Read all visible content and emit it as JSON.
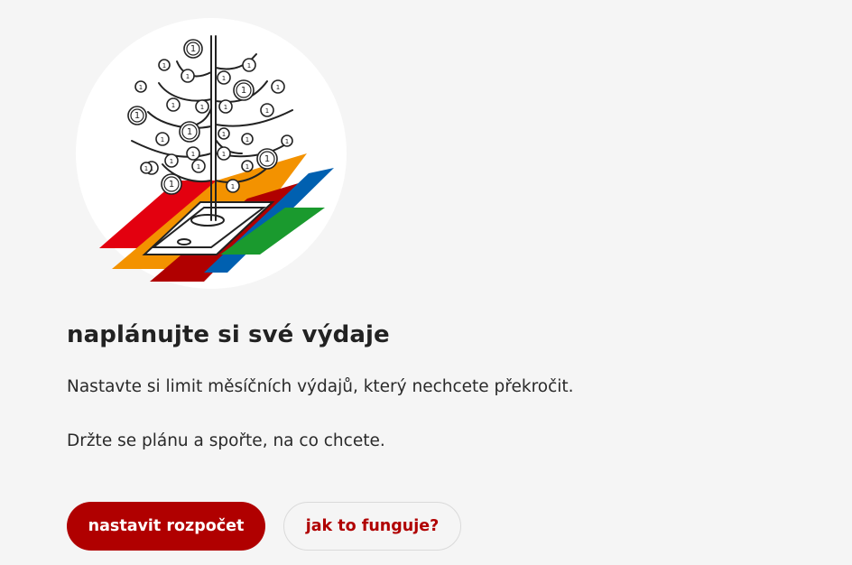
{
  "illustration": {
    "icon": "money-tree-phone-icon",
    "coin_label": "1",
    "colors": {
      "circle": "#ffffff",
      "red": "#e3000f",
      "orange": "#f39200",
      "dark_red": "#b00000",
      "blue": "#0060b0",
      "green": "#1a9a2e",
      "line": "#222222"
    }
  },
  "content": {
    "heading": "naplánujte si své výdaje",
    "paragraph1": "Nastavte si limit měsíčních výdajů, který nechcete překročit.",
    "paragraph2": "Držte se plánu a spořte, na co chcete."
  },
  "actions": {
    "primary_label": "nastavit rozpočet",
    "secondary_label": "jak to funguje?",
    "accent_color": "#b00000"
  }
}
